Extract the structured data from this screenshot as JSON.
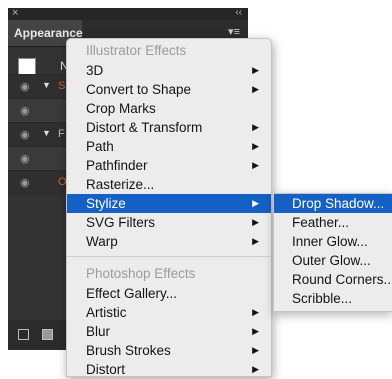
{
  "panel": {
    "close_glyph": "×",
    "collapse_glyph": "‹‹",
    "tab_label": "Appearance",
    "menu_glyph": "▾≡",
    "swatch_label": "N",
    "row_label_1": "S",
    "row_label_2": "F",
    "row_label_3": "O",
    "eye_glyph": "◉",
    "tri_glyph": "▼"
  },
  "menu": {
    "illustrator_header": "Illustrator Effects",
    "illustrator_items": [
      {
        "label": "3D",
        "submenu": true
      },
      {
        "label": "Convert to Shape",
        "submenu": true
      },
      {
        "label": "Crop Marks",
        "submenu": false
      },
      {
        "label": "Distort & Transform",
        "submenu": true
      },
      {
        "label": "Path",
        "submenu": true
      },
      {
        "label": "Pathfinder",
        "submenu": true
      },
      {
        "label": "Rasterize...",
        "submenu": false
      },
      {
        "label": "Stylize",
        "submenu": true,
        "selected": true
      },
      {
        "label": "SVG Filters",
        "submenu": true
      },
      {
        "label": "Warp",
        "submenu": true
      }
    ],
    "photoshop_header": "Photoshop Effects",
    "photoshop_items": [
      {
        "label": "Effect Gallery...",
        "submenu": false
      },
      {
        "label": "Artistic",
        "submenu": true
      },
      {
        "label": "Blur",
        "submenu": true
      },
      {
        "label": "Brush Strokes",
        "submenu": true
      },
      {
        "label": "Distort",
        "submenu": true
      }
    ],
    "arrow_glyph": "▶"
  },
  "submenu": {
    "items": [
      {
        "label": "Drop Shadow...",
        "selected": true
      },
      {
        "label": "Feather..."
      },
      {
        "label": "Inner Glow..."
      },
      {
        "label": "Outer Glow..."
      },
      {
        "label": "Round Corners..."
      },
      {
        "label": "Scribble..."
      }
    ]
  },
  "colors": {
    "selection": "#1560c4",
    "panel_bg": "#333333",
    "menu_bg": "#ececec",
    "accent_orange": "#d06a1e"
  }
}
